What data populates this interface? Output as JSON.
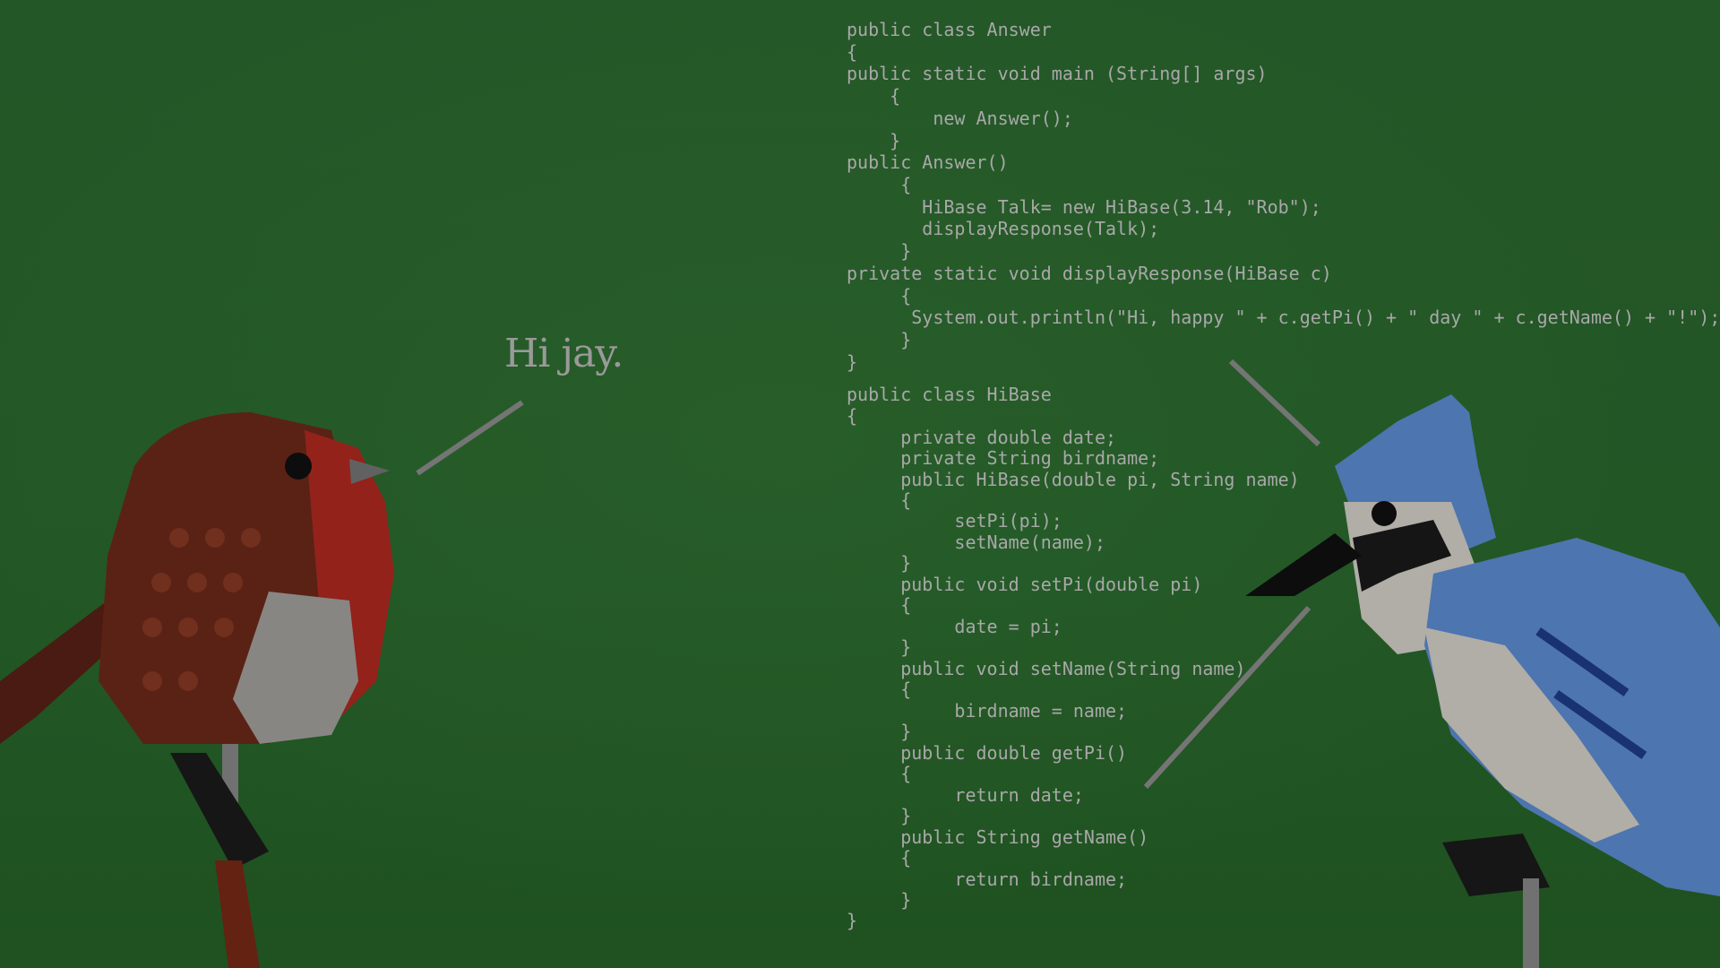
{
  "colors": {
    "background": "#2c6a2f",
    "text": "#a8a8a8",
    "robin_brown": "#6e2a1a",
    "robin_red": "#b42a22",
    "jay_blue": "#5f8fd6",
    "jay_white": "#d8d4cc"
  },
  "speech": {
    "robin": "Hi jay."
  },
  "code_lines": [
    "public class Answer",
    "{",
    "public static void main (String[] args)",
    "    {",
    "        new Answer();",
    "    }",
    "public Answer()",
    "     {",
    "       HiBase Talk= new HiBase(3.14, \"Rob\");",
    "       displayResponse(Talk);",
    "     }",
    "private static void displayResponse(HiBase c)",
    "     {",
    "      System.out.println(\"Hi, happy \" + c.getPi() + \" day \" + c.getName() + \"!\");",
    "     }",
    "}",
    "public class HiBase",
    "{",
    "     private double date;",
    "     private String birdname;",
    "     public HiBase(double pi, String name)",
    "     {",
    "          setPi(pi);",
    "          setName(name);",
    "     }",
    "     public void setPi(double pi)",
    "     {",
    "          date = pi;",
    "     }",
    "     public void setName(String name)",
    "     {",
    "          birdname = name;",
    "     }",
    "     public double getPi()",
    "     {",
    "          return date;",
    "     }",
    "     public String getName()",
    "     {",
    "          return birdname;",
    "     }",
    "}"
  ]
}
